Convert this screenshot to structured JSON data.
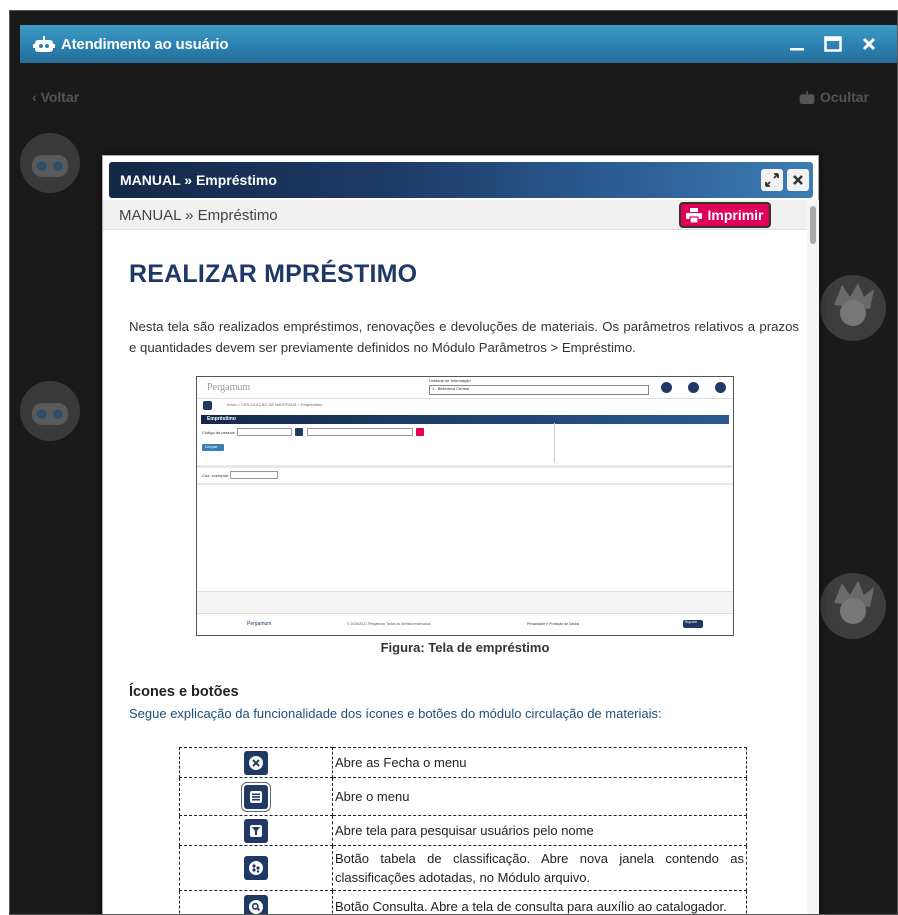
{
  "window": {
    "title": "Atendimento ao usuário"
  },
  "subbar": {
    "back": "Voltar",
    "hide": "Ocultar"
  },
  "modal": {
    "title": "MANUAL » Empréstimo",
    "breadcrumb": "MANUAL » Empréstimo",
    "print_label": "Imprimir"
  },
  "content": {
    "heading": "REALIZAR MPRÉSTIMO",
    "intro": "Nesta tela são realizados empréstimos, renovações e devoluções de materiais. Os parâmetros relativos a prazos e quantidades devem ser previamente definidos no Módulo Parâmetros > Empréstimo.",
    "figure_caption": "Figura: Tela de empréstimo",
    "figure": {
      "brand": "Pergamum",
      "unit_label": "Unidade de Informação",
      "unit_value": "1 - Biblioteca Central",
      "breadcrumb": "Início > CIRCULAÇÃO DE MATERIAIS > Empréstimo",
      "panel_title": "Empréstimo",
      "field_user": "Código da pessoa:",
      "btn_limpar": "Limpar",
      "field_exemplar": "Cód. exemplar:",
      "footer_copy": "© 2024/2021 Pergamum Todos os direitos reservados",
      "footer_policy": "Privacidade e Proteção de Dados",
      "footer_support": "Suporte"
    },
    "icons_title": "Ícones e botões",
    "icons_sub": "Segue explicação da funcionalidade dos ícones e botões do módulo circulação de materiais:",
    "rows": [
      {
        "icon": "close-circle-icon",
        "text": "Abre as Fecha o menu"
      },
      {
        "icon": "menu-icon",
        "text": "Abre o menu"
      },
      {
        "icon": "user-search-icon",
        "text": "Abre tela para pesquisar usuários pelo nome"
      },
      {
        "icon": "classification-icon",
        "text": "Botão tabela de classificação. Abre nova janela contendo as classificações adotadas, no Módulo arquivo."
      },
      {
        "icon": "search-icon",
        "text": "Botão Consulta. Abre a tela de consulta para auxílio ao catalogador."
      }
    ]
  },
  "colors": {
    "titlebar": "#2a7fae",
    "modal_header": "#1d3a66",
    "print": "#e0005a",
    "heading": "#1f3864"
  }
}
